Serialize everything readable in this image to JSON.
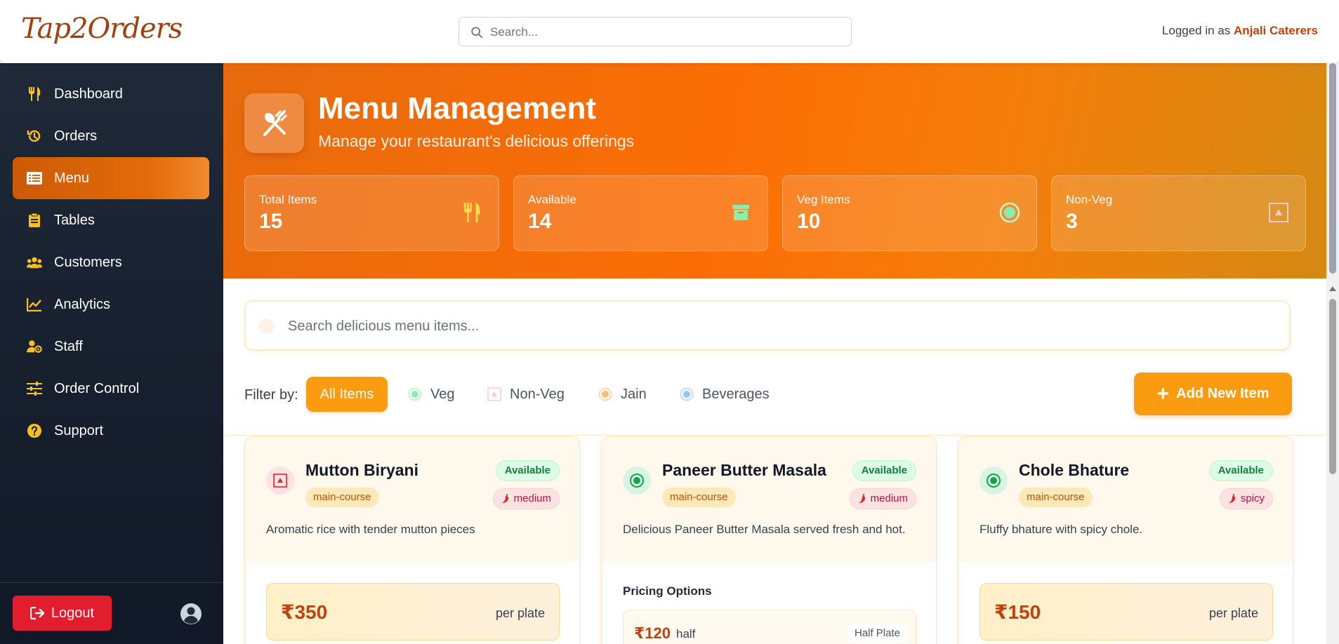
{
  "app": {
    "logo": "Tap2Orders",
    "search_placeholder": "Search...",
    "login_prefix": "Logged in as ",
    "login_user": "Anjali Caterers"
  },
  "sidebar": {
    "items": [
      {
        "label": "Dashboard",
        "icon": "utensils-icon"
      },
      {
        "label": "Orders",
        "icon": "history-icon"
      },
      {
        "label": "Menu",
        "icon": "menu-list-icon",
        "active": true
      },
      {
        "label": "Tables",
        "icon": "clipboard-icon"
      },
      {
        "label": "Customers",
        "icon": "users-icon"
      },
      {
        "label": "Analytics",
        "icon": "chart-line-icon"
      },
      {
        "label": "Staff",
        "icon": "user-gear-icon"
      },
      {
        "label": "Order Control",
        "icon": "sliders-icon"
      },
      {
        "label": "Support",
        "icon": "question-circle-icon"
      }
    ],
    "logout_label": "Logout"
  },
  "hero": {
    "title": "Menu Management",
    "subtitle": "Manage your restaurant's delicious offerings",
    "stats": [
      {
        "label": "Total Items",
        "value": "15",
        "icon": "utensils-icon"
      },
      {
        "label": "Available",
        "value": "14",
        "icon": "archive-box-icon"
      },
      {
        "label": "Veg Items",
        "value": "10",
        "icon": "veg-dot-icon"
      },
      {
        "label": "Non-Veg",
        "value": "3",
        "icon": "nonveg-triangle-icon"
      }
    ]
  },
  "menu": {
    "search_placeholder": "Search delicious menu items...",
    "filter_label": "Filter by:",
    "filters": [
      "All Items",
      "Veg",
      "Non-Veg",
      "Jain",
      "Beverages"
    ],
    "active_filter": "All Items",
    "add_label": "Add New Item",
    "items": [
      {
        "name": "Mutton Biryani",
        "type": "non-veg",
        "category": "main-course",
        "status": "Available",
        "spice": "medium",
        "description": "Aromatic rice with tender mutton pieces",
        "price": "₹350",
        "unit": "per plate"
      },
      {
        "name": "Paneer Butter Masala",
        "type": "veg",
        "category": "main-course",
        "status": "Available",
        "spice": "medium",
        "description": "Delicious Paneer Butter Masala served fresh and hot.",
        "pricing_title": "Pricing Options",
        "options": [
          {
            "price": "₹120",
            "name": "half",
            "tag": "Half Plate"
          }
        ]
      },
      {
        "name": "Chole Bhature",
        "type": "veg",
        "category": "main-course",
        "status": "Available",
        "spice": "spicy",
        "description": "Fluffy bhature with spicy chole.",
        "price": "₹150",
        "unit": "per plate"
      }
    ]
  },
  "colors": {
    "accent": "#fb9b10",
    "brand_dark": "#c2410c",
    "sidebar_bg": "#1f2937",
    "logout": "#e11d2e",
    "veg": "#16a34a",
    "nonveg": "#dc2626"
  }
}
